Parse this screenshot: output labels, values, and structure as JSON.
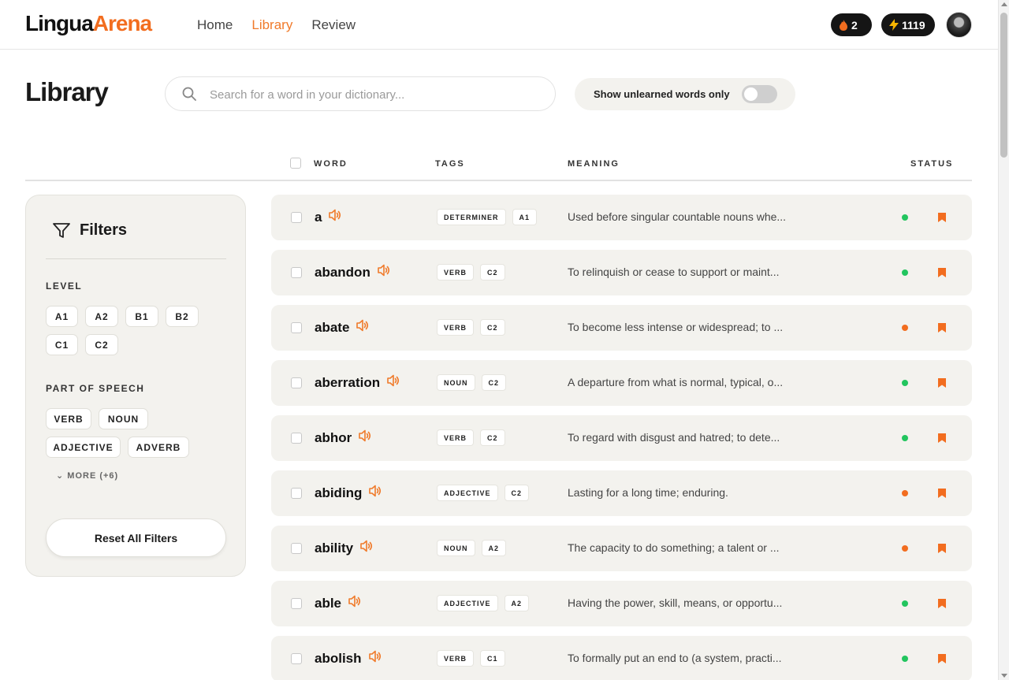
{
  "app": {
    "logo_part1": "Lingua",
    "logo_part2": "Arena"
  },
  "nav": [
    {
      "label": "Home",
      "active": false
    },
    {
      "label": "Library",
      "active": true
    },
    {
      "label": "Review",
      "active": false
    }
  ],
  "stats": {
    "streak": "2",
    "xp": "1119"
  },
  "page": {
    "title": "Library",
    "search_placeholder": "Search for a word in your dictionary...",
    "toggle_label": "Show unlearned words only"
  },
  "table": {
    "headers": {
      "word": "WORD",
      "tags": "TAGS",
      "meaning": "MEANING",
      "status": "STATUS"
    },
    "rows": [
      {
        "word": "a",
        "tags": [
          "DETERMINER",
          "A1"
        ],
        "meaning": "Used before singular countable nouns whe...",
        "status": "green"
      },
      {
        "word": "abandon",
        "tags": [
          "VERB",
          "C2"
        ],
        "meaning": "To relinquish or cease to support or maint...",
        "status": "green"
      },
      {
        "word": "abate",
        "tags": [
          "VERB",
          "C2"
        ],
        "meaning": "To become less intense or widespread; to ...",
        "status": "orange"
      },
      {
        "word": "aberration",
        "tags": [
          "NOUN",
          "C2"
        ],
        "meaning": "A departure from what is normal, typical, o...",
        "status": "green"
      },
      {
        "word": "abhor",
        "tags": [
          "VERB",
          "C2"
        ],
        "meaning": "To regard with disgust and hatred; to dete...",
        "status": "green"
      },
      {
        "word": "abiding",
        "tags": [
          "ADJECTIVE",
          "C2"
        ],
        "meaning": "Lasting for a long time; enduring.",
        "status": "orange"
      },
      {
        "word": "ability",
        "tags": [
          "NOUN",
          "A2"
        ],
        "meaning": "The capacity to do something; a talent or ...",
        "status": "orange"
      },
      {
        "word": "able",
        "tags": [
          "ADJECTIVE",
          "A2"
        ],
        "meaning": "Having the power, skill, means, or opportu...",
        "status": "green"
      },
      {
        "word": "abolish",
        "tags": [
          "VERB",
          "C1"
        ],
        "meaning": "To formally put an end to (a system, practi...",
        "status": "green"
      }
    ]
  },
  "filters": {
    "title": "Filters",
    "level_label": "LEVEL",
    "levels": [
      "A1",
      "A2",
      "B1",
      "B2",
      "C1",
      "C2"
    ],
    "pos_label": "PART OF SPEECH",
    "pos": [
      "VERB",
      "NOUN",
      "ADJECTIVE",
      "ADVERB"
    ],
    "more_label": "MORE (+6)",
    "reset_label": "Reset All Filters"
  },
  "colors": {
    "accent": "#f07a2a",
    "green": "#22c55e",
    "orange": "#f26d1f",
    "panel": "#f3f2ee"
  }
}
